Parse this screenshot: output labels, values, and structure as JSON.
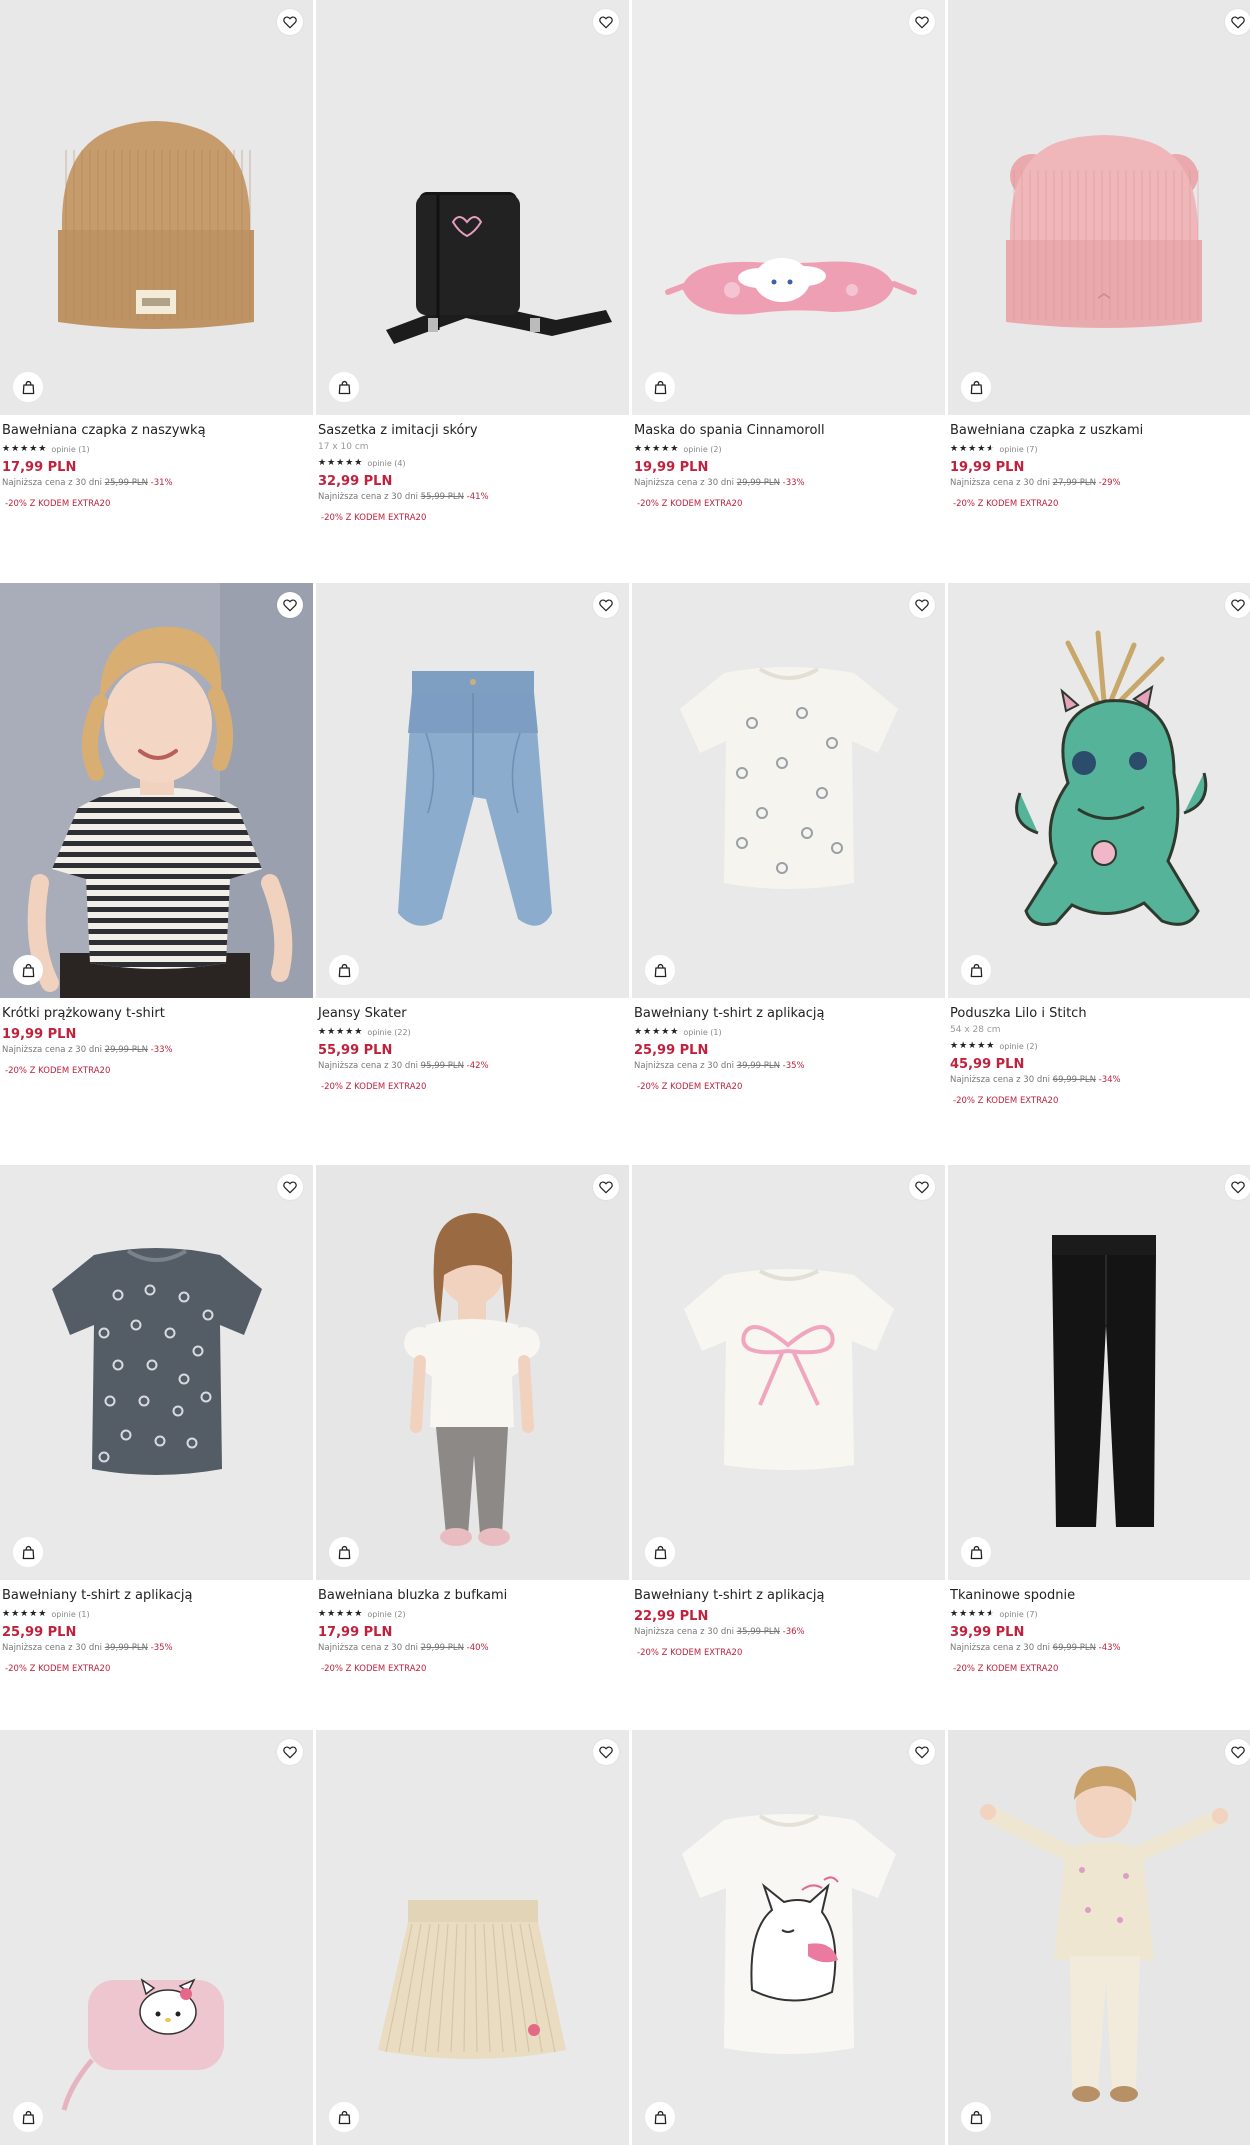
{
  "icons": {
    "wishlist": "heart-icon",
    "add_to_cart": "shopping-bag-icon"
  },
  "colors": {
    "price": "#c0213c",
    "discount": "#c0213c",
    "promo": "#c0213c",
    "text": "#222222"
  },
  "products": [
    {
      "name": "Bawełniana czapka z naszywką",
      "dims": "",
      "rating": 5,
      "reviews": "opinie (1)",
      "price": "17,99 PLN",
      "lowest_label": "Najniższa cena z 30 dni",
      "old_price": "25,99 PLN",
      "discount": "-31%",
      "promo": "-20% Z KODEM EXTRA20",
      "art": "beanie-tan"
    },
    {
      "name": "Saszetka z imitacji skóry",
      "dims": "17 x 10 cm",
      "rating": 5,
      "reviews": "opinie (4)",
      "price": "32,99 PLN",
      "lowest_label": "Najniższa cena z 30 dni",
      "old_price": "55,99 PLN",
      "discount": "-41%",
      "promo": "-20% Z KODEM EXTRA20",
      "art": "bag-black"
    },
    {
      "name": "Maska do spania Cinnamoroll",
      "dims": "",
      "rating": 5,
      "reviews": "opinie (2)",
      "price": "19,99 PLN",
      "lowest_label": "Najniższa cena z 30 dni",
      "old_price": "29,99 PLN",
      "discount": "-33%",
      "promo": "-20% Z KODEM EXTRA20",
      "art": "sleep-mask"
    },
    {
      "name": "Bawełniana czapka z uszkami",
      "dims": "",
      "rating": 4.5,
      "reviews": "opinie (7)",
      "price": "19,99 PLN",
      "lowest_label": "Najniższa cena z 30 dni",
      "old_price": "27,99 PLN",
      "discount": "-29%",
      "promo": "-20% Z KODEM EXTRA20",
      "art": "beanie-pink"
    },
    {
      "name": "Krótki prążkowany t-shirt",
      "dims": "",
      "rating": null,
      "reviews": "",
      "price": "19,99 PLN",
      "lowest_label": "Najniższa cena z 30 dni",
      "old_price": "29,99 PLN",
      "discount": "-33%",
      "promo": "-20% Z KODEM EXTRA20",
      "art": "girl-stripes"
    },
    {
      "name": "Jeansy Skater",
      "dims": "",
      "rating": 5,
      "reviews": "opinie (22)",
      "price": "55,99 PLN",
      "lowest_label": "Najniższa cena z 30 dni",
      "old_price": "95,99 PLN",
      "discount": "-42%",
      "promo": "-20% Z KODEM EXTRA20",
      "art": "jeans"
    },
    {
      "name": "Bawełniany t-shirt z aplikacją",
      "dims": "",
      "rating": 5,
      "reviews": "opinie (1)",
      "price": "25,99 PLN",
      "lowest_label": "Najniższa cena z 30 dni",
      "old_price": "39,99 PLN",
      "discount": "-35%",
      "promo": "-20% Z KODEM EXTRA20",
      "art": "tee-white-studs"
    },
    {
      "name": "Poduszka Lilo i Stitch",
      "dims": "54 x 28 cm",
      "rating": 5,
      "reviews": "opinie (2)",
      "price": "45,99 PLN",
      "lowest_label": "Najniższa cena z 30 dni",
      "old_price": "69,99 PLN",
      "discount": "-34%",
      "promo": "-20% Z KODEM EXTRA20",
      "art": "scrump"
    },
    {
      "name": "Bawełniany t-shirt z aplikacją",
      "dims": "",
      "rating": 5,
      "reviews": "opinie (1)",
      "price": "25,99 PLN",
      "lowest_label": "Najniższa cena z 30 dni",
      "old_price": "39,99 PLN",
      "discount": "-35%",
      "promo": "-20% Z KODEM EXTRA20",
      "art": "tee-grey-studs"
    },
    {
      "name": "Bawełniana bluzka z bufkami",
      "dims": "",
      "rating": 5,
      "reviews": "opinie (2)",
      "price": "17,99 PLN",
      "lowest_label": "Najniższa cena z 30 dni",
      "old_price": "29,99 PLN",
      "discount": "-40%",
      "promo": "-20% Z KODEM EXTRA20",
      "art": "girl-blouse"
    },
    {
      "name": "Bawełniany t-shirt z aplikacją",
      "dims": "",
      "rating": null,
      "reviews": "",
      "price": "22,99 PLN",
      "lowest_label": "Najniższa cena z 30 dni",
      "old_price": "35,99 PLN",
      "discount": "-36%",
      "promo": "-20% Z KODEM EXTRA20",
      "art": "tee-bow"
    },
    {
      "name": "Tkaninowe spodnie",
      "dims": "",
      "rating": 4.5,
      "reviews": "opinie (7)",
      "price": "39,99 PLN",
      "lowest_label": "Najniższa cena z 30 dni",
      "old_price": "69,99 PLN",
      "discount": "-43%",
      "promo": "-20% Z KODEM EXTRA20",
      "art": "trousers"
    },
    {
      "name": "",
      "dims": "",
      "rating": null,
      "reviews": "",
      "price": "",
      "lowest_label": "",
      "old_price": "",
      "discount": "",
      "promo": "",
      "art": "hello-kitty-pouch"
    },
    {
      "name": "",
      "dims": "",
      "rating": null,
      "reviews": "",
      "price": "",
      "lowest_label": "",
      "old_price": "",
      "discount": "",
      "promo": "",
      "art": "skirt"
    },
    {
      "name": "",
      "dims": "",
      "rating": null,
      "reviews": "",
      "price": "",
      "lowest_label": "",
      "old_price": "",
      "discount": "",
      "promo": "",
      "art": "tee-cat"
    },
    {
      "name": "",
      "dims": "",
      "rating": null,
      "reviews": "",
      "price": "",
      "lowest_label": "",
      "old_price": "",
      "discount": "",
      "promo": "",
      "art": "girl-cardigan"
    }
  ]
}
